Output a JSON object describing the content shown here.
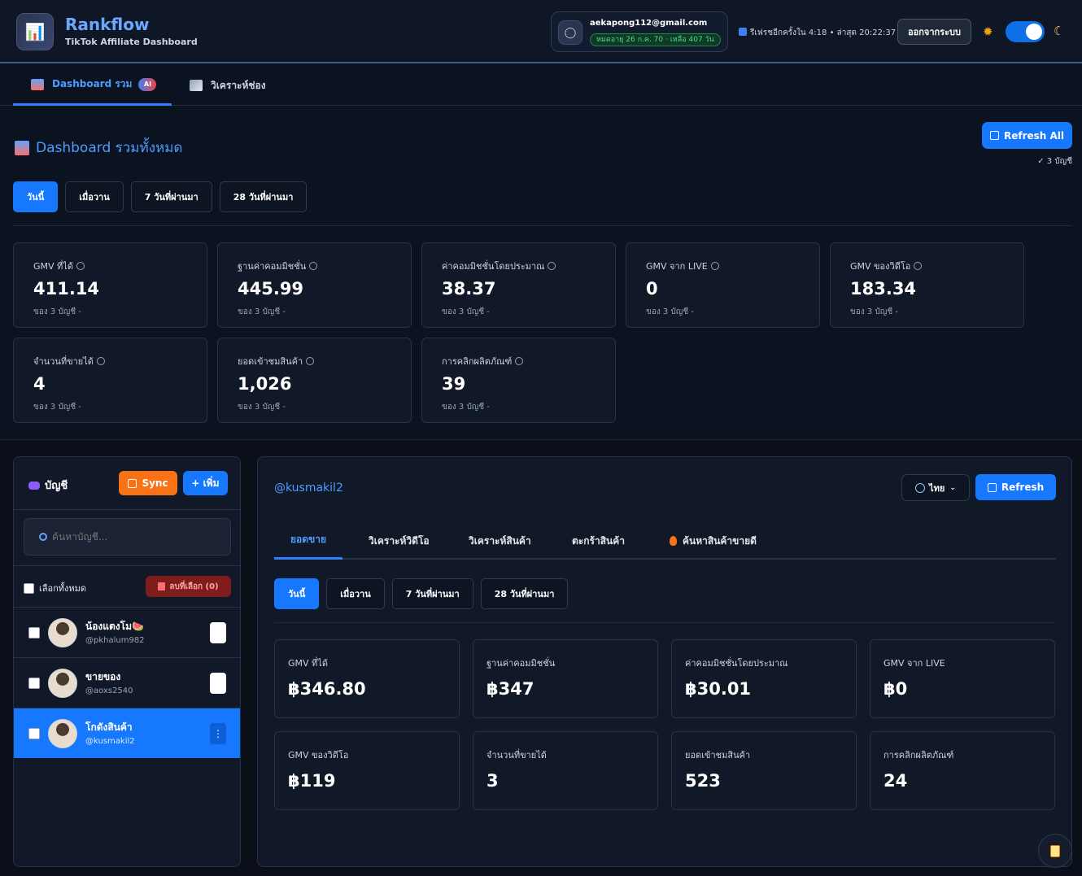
{
  "header": {
    "brand": "Rankflow",
    "subtitle": "TikTok Affiliate Dashboard",
    "user_email": "aekapong112@gmail.com",
    "plan_badge": "หมดอายุ 26 ก.ค. 70 · เหลือ 407 วัน",
    "refresh_info": "รีเฟรชอีกครั้งใน 4:18 • ล่าสุด 20:22:37",
    "logout_label": "ออกจากระบบ",
    "theme_dark": true
  },
  "topnav": {
    "tab1_label": "Dashboard รวม",
    "tab1_badge": "AI",
    "tab2_label": "วิเคราะห์ช่อง"
  },
  "dashboard": {
    "title": "Dashboard รวมทั้งหมด",
    "refresh_all_label": "Refresh All",
    "account_count": "✓ 3 บัญชี",
    "ranges": [
      "วันนี้",
      "เมื่อวาน",
      "7 วันที่ผ่านมา",
      "28 วันที่ผ่านมา"
    ],
    "active_range": "วันนี้",
    "stats": [
      {
        "label": "GMV ที่ได้",
        "value": "411.14",
        "sub": "ของ 3 บัญชี -"
      },
      {
        "label": "ฐานค่าคอมมิชชั่น",
        "value": "445.99",
        "sub": "ของ 3 บัญชี -"
      },
      {
        "label": "ค่าคอมมิชชั่นโดยประมาณ",
        "value": "38.37",
        "sub": "ของ 3 บัญชี -"
      },
      {
        "label": "GMV จาก LIVE",
        "value": "0",
        "sub": "ของ 3 บัญชี -"
      },
      {
        "label": "GMV ของวิดีโอ",
        "value": "183.34",
        "sub": "ของ 3 บัญชี -"
      },
      {
        "label": "จำนวนที่ขายได้",
        "value": "4",
        "sub": "ของ 3 บัญชี -"
      },
      {
        "label": "ยอดเข้าชมสินค้า",
        "value": "1,026",
        "sub": "ของ 3 บัญชี -"
      },
      {
        "label": "การคลิกผลิตภัณฑ์",
        "value": "39",
        "sub": "ของ 3 บัญชี -"
      }
    ]
  },
  "accounts": {
    "title": "บัญชี",
    "sync_label": "Sync",
    "add_label": "+ เพิ่ม",
    "search_placeholder": "ค้นหาบัญชี...",
    "select_all_label": "เลือกทั้งหมด",
    "delete_selected_label": "ลบที่เลือก (0)",
    "items": [
      {
        "name": "น้องแตงโม🍉",
        "handle": "@pkhalum982",
        "active": false
      },
      {
        "name": "ขายของ",
        "handle": "@aoxs2540",
        "active": false
      },
      {
        "name": "โกดังสินค้า",
        "handle": "@kusmakil2",
        "active": true
      }
    ]
  },
  "detail": {
    "handle": "@kusmakil2",
    "language_label": "ไทย",
    "refresh_label": "Refresh",
    "tabs": [
      "ยอดขาย",
      "วิเคราะห์วิดีโอ",
      "วิเคราะห์สินค้า",
      "ตะกร้าสินค้า",
      "ค้นหาสินค้าขายดี"
    ],
    "active_tab": "ยอดขาย",
    "ranges": [
      "วันนี้",
      "เมื่อวาน",
      "7 วันที่ผ่านมา",
      "28 วันที่ผ่านมา"
    ],
    "active_range": "วันนี้",
    "stats": [
      {
        "label": "GMV ที่ได้",
        "value": "฿346.80"
      },
      {
        "label": "ฐานค่าคอมมิชชั่น",
        "value": "฿347"
      },
      {
        "label": "ค่าคอมมิชชั่นโดยประมาณ",
        "value": "฿30.01"
      },
      {
        "label": "GMV จาก LIVE",
        "value": "฿0"
      },
      {
        "label": "GMV ของวิดีโอ",
        "value": "฿119"
      },
      {
        "label": "จำนวนที่ขายได้",
        "value": "3"
      },
      {
        "label": "ยอดเข้าชมสินค้า",
        "value": "523"
      },
      {
        "label": "การคลิกผลิตภัณฑ์",
        "value": "24"
      }
    ]
  },
  "colors": {
    "accent": "#1677ff",
    "sync": "#f97316",
    "background": "#0b1220"
  }
}
